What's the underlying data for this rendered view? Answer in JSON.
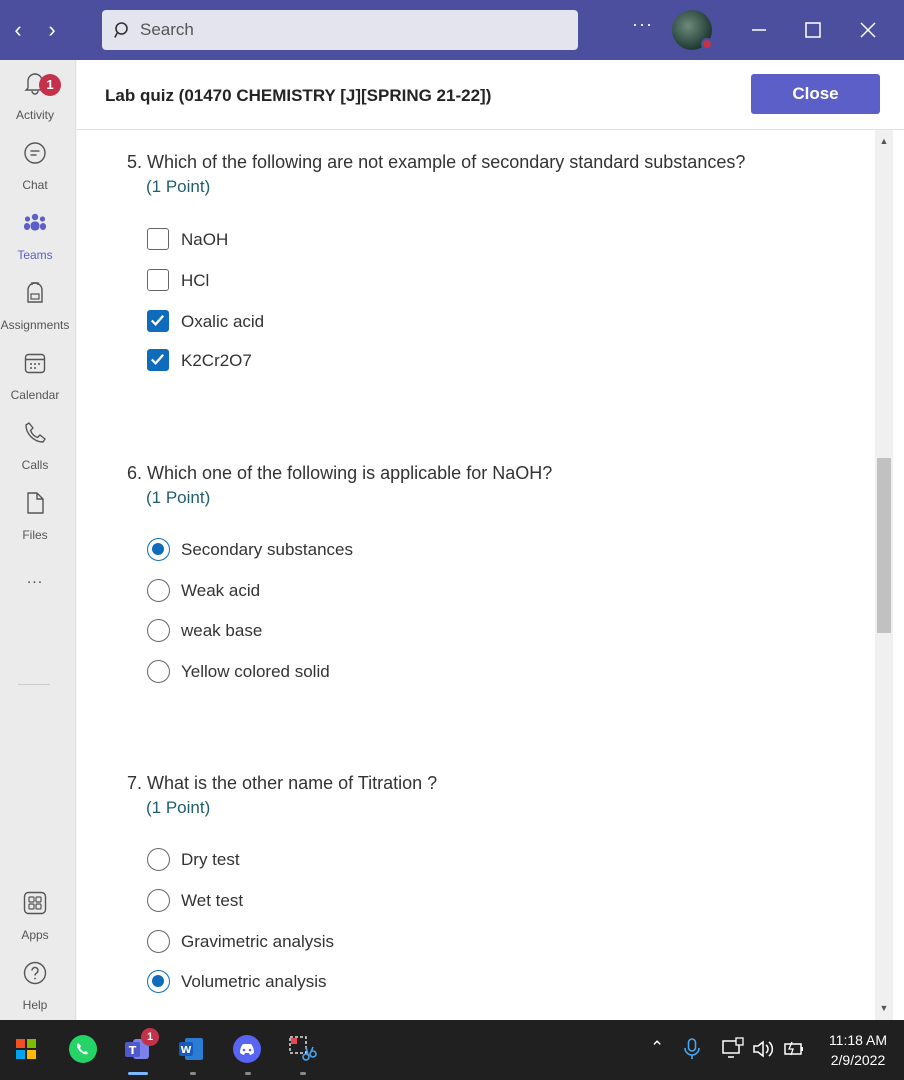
{
  "titlebar": {
    "search_placeholder": "Search",
    "more_label": "···"
  },
  "rail": {
    "items": [
      {
        "label": "Activity",
        "icon": "bell-icon",
        "badge": "1"
      },
      {
        "label": "Chat",
        "icon": "chat-icon"
      },
      {
        "label": "Teams",
        "icon": "teams-icon",
        "active": true
      },
      {
        "label": "Assignments",
        "icon": "backpack-icon"
      },
      {
        "label": "Calendar",
        "icon": "calendar-icon"
      },
      {
        "label": "Calls",
        "icon": "phone-icon"
      },
      {
        "label": "Files",
        "icon": "file-icon"
      },
      {
        "label": "...",
        "icon": "more-icon"
      },
      {
        "label": "Apps",
        "icon": "apps-icon"
      },
      {
        "label": "Help",
        "icon": "help-icon"
      }
    ]
  },
  "header": {
    "title": "Lab quiz (01470 CHEMISTRY [J][SPRING 21-22])",
    "close_label": "Close"
  },
  "questions": [
    {
      "text": "5. Which of the following are not example of  secondary standard substances?",
      "points": "(1 Point)",
      "type": "checkbox",
      "options": [
        {
          "label": "NaOH",
          "selected": false
        },
        {
          "label": "HCl",
          "selected": false
        },
        {
          "label": "Oxalic acid",
          "selected": true
        },
        {
          "label": "K2Cr2O7",
          "selected": true
        }
      ]
    },
    {
      "text": "6. Which one of the following is applicable for NaOH?",
      "points": "(1 Point)",
      "type": "radio",
      "options": [
        {
          "label": "Secondary substances",
          "selected": true
        },
        {
          "label": "Weak acid",
          "selected": false
        },
        {
          "label": "weak base",
          "selected": false
        },
        {
          "label": "Yellow colored solid",
          "selected": false
        }
      ]
    },
    {
      "text": "7. What is the other name of  Titration ?",
      "points": "(1 Point)",
      "type": "radio",
      "options": [
        {
          "label": "Dry test",
          "selected": false
        },
        {
          "label": "Wet test",
          "selected": false
        },
        {
          "label": "Gravimetric analysis",
          "selected": false
        },
        {
          "label": "Volumetric analysis",
          "selected": true
        }
      ]
    }
  ],
  "taskbar": {
    "apps": [
      "windows-start-icon",
      "whatsapp-icon",
      "teams-app-icon",
      "word-icon",
      "discord-icon",
      "snipping-tool-icon"
    ],
    "teams_badge": "1",
    "time": "11:18 AM",
    "date": "2/9/2022"
  },
  "colors": {
    "titlebar": "#4b4f9e",
    "accent": "#5b5fc7",
    "check": "#0f6cbd",
    "points": "#1f5f6b"
  }
}
